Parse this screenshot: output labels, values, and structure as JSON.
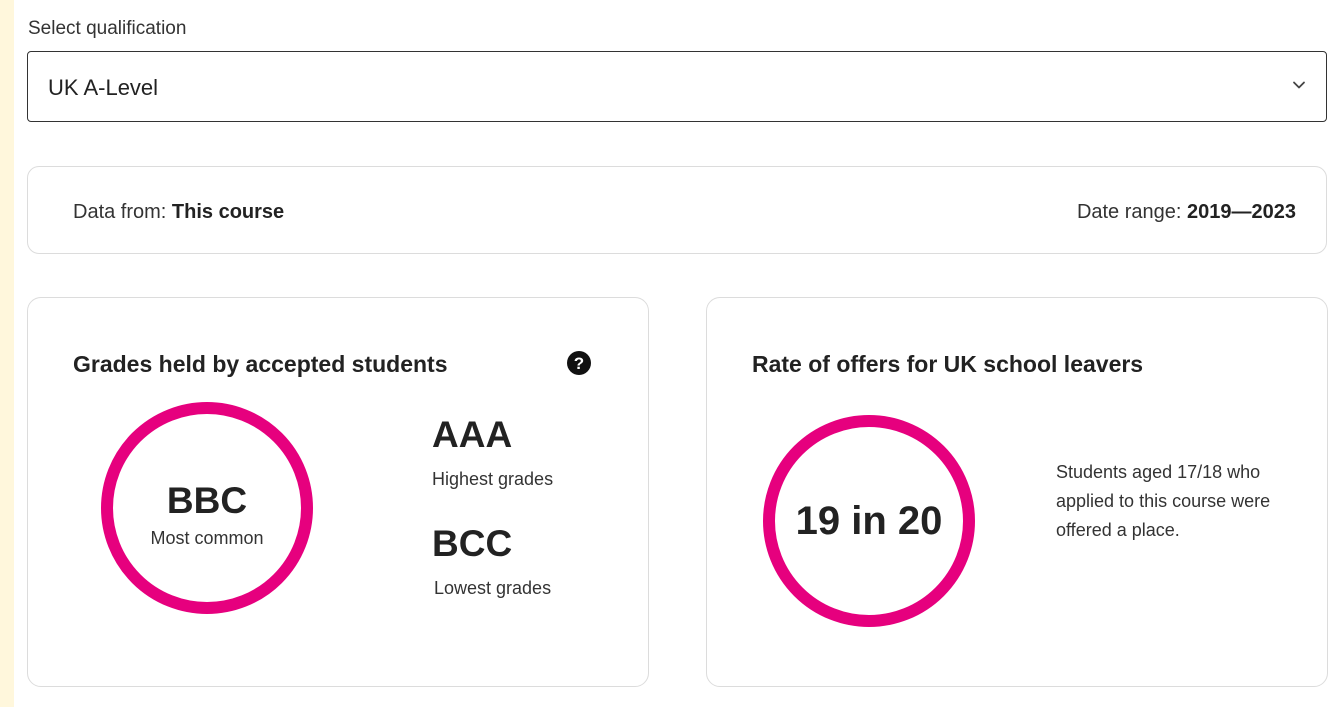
{
  "qualification": {
    "label": "Select qualification",
    "selected": "UK A-Level"
  },
  "info_bar": {
    "data_from_label": "Data from:",
    "data_from_value": "This course",
    "date_range_label": "Date range:",
    "date_range_value": "2019—2023"
  },
  "grades_card": {
    "title": "Grades held by accepted students",
    "most_common_grade": "BBC",
    "most_common_label": "Most common",
    "highest_grade": "AAA",
    "highest_label": "Highest grades",
    "lowest_grade": "BCC",
    "lowest_label": "Lowest grades"
  },
  "offers_card": {
    "title": "Rate of offers for UK school leavers",
    "rate": "19 in 20",
    "description": "Students aged 17/18 who applied to this course were offered a place."
  },
  "colors": {
    "accent": "#e6007e",
    "page_background": "#fff7dc"
  },
  "icons": {
    "dropdown": "chevron-down-icon",
    "help": "question-circle-icon"
  }
}
